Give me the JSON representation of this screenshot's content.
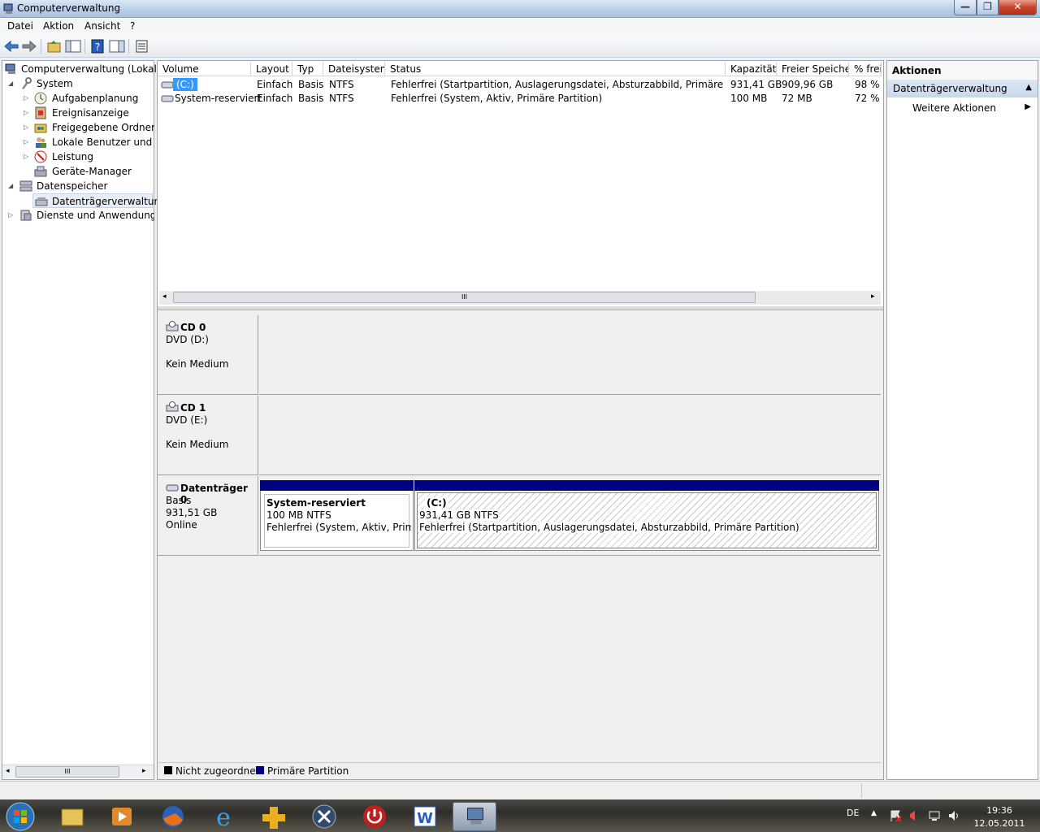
{
  "window": {
    "title": "Computerverwaltung",
    "min": "—",
    "max": "❐",
    "close": "✕"
  },
  "menubar": {
    "items": [
      "Datei",
      "Aktion",
      "Ansicht",
      "?"
    ]
  },
  "tree": {
    "items": [
      {
        "label": "Computerverwaltung (Lokal)",
        "expander": "",
        "icon": "computer-management-icon"
      },
      {
        "label": "System",
        "expander": "◢",
        "icon": "system-tools-icon"
      },
      {
        "label": "Aufgabenplanung",
        "expander": "▷",
        "icon": "task-scheduler-icon"
      },
      {
        "label": "Ereignisanzeige",
        "expander": "▷",
        "icon": "event-viewer-icon"
      },
      {
        "label": "Freigegebene Ordner",
        "expander": "▷",
        "icon": "shared-folders-icon"
      },
      {
        "label": "Lokale Benutzer und Gruppen",
        "expander": "▷",
        "icon": "local-users-icon"
      },
      {
        "label": "Leistung",
        "expander": "▷",
        "icon": "performance-icon"
      },
      {
        "label": "Geräte-Manager",
        "expander": "",
        "icon": "device-manager-icon"
      },
      {
        "label": "Datenspeicher",
        "expander": "◢",
        "icon": "storage-icon"
      },
      {
        "label": "Datenträgerverwaltung",
        "expander": "",
        "icon": "disk-management-icon"
      },
      {
        "label": "Dienste und Anwendungen",
        "expander": "▷",
        "icon": "services-icon"
      }
    ]
  },
  "volumes": {
    "columns": [
      "Volume",
      "Layout",
      "Typ",
      "Dateisystem",
      "Status",
      "Kapazität",
      "Freier Speicher",
      "% frei"
    ],
    "rows": [
      [
        "(C:)",
        "Einfach",
        "Basis",
        "NTFS",
        "Fehlerfrei (Startpartition, Auslagerungsdatei, Absturzabbild, Primäre Partition)",
        "931,41 GB",
        "909,96 GB",
        "98 %"
      ],
      [
        "System-reserviert",
        "Einfach",
        "Basis",
        "NTFS",
        "Fehlerfrei (System, Aktiv, Primäre Partition)",
        "100 MB",
        "72 MB",
        "72 %"
      ]
    ],
    "scroll_grip": "III"
  },
  "disks": {
    "cd0": {
      "name": "CD 0",
      "type": "DVD (D:)",
      "status": "Kein Medium"
    },
    "cd1": {
      "name": "CD 1",
      "type": "DVD (E:)",
      "status": "Kein Medium"
    },
    "disk0": {
      "name": "Datenträger 0",
      "type": "Basis",
      "size": "931,51 GB",
      "status": "Online",
      "partitions": [
        {
          "name": "System-reserviert",
          "size": "100 MB NTFS",
          "status": "Fehlerfrei (System, Aktiv, Primäre"
        },
        {
          "name": "(C:)",
          "size": "931,41 GB NTFS",
          "status": "Fehlerfrei (Startpartition, Auslagerungsdatei, Absturzabbild, Primäre Partition)"
        }
      ]
    }
  },
  "legend": {
    "unallocated": "Nicht zugeordnet",
    "primary": "Primäre Partition",
    "unallocated_color": "#000000",
    "primary_color": "#000080"
  },
  "actions": {
    "header": "Aktionen",
    "section": "Datenträgerverwaltung",
    "item": "Weitere Aktionen"
  },
  "tree_scroll_grip": "III",
  "taskbar": {
    "lang": "DE",
    "time": "19:36",
    "date": "12.05.2011"
  }
}
